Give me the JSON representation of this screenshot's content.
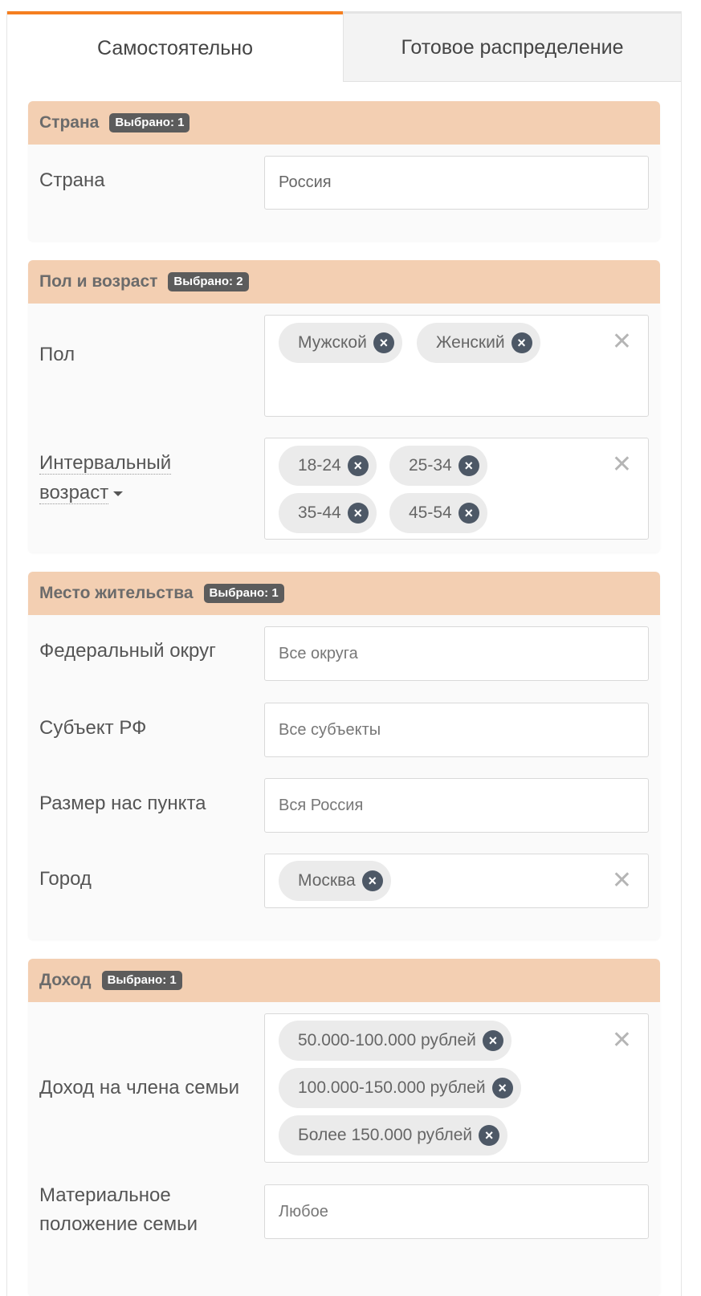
{
  "tabs": {
    "active": "Самостоятельно",
    "inactive": "Готовое распределение"
  },
  "colors": {
    "accent": "#f57f20",
    "section_header_bg": "#f3cfb2",
    "badge_bg": "#5c5c5c",
    "chip_bg": "#ebebeb",
    "chip_remove_bg": "#4d5866"
  },
  "icons": {
    "chip_remove": "close-circle-icon",
    "clear": "close-icon",
    "dropdown": "caret-down-icon"
  },
  "sections": {
    "country": {
      "title": "Страна",
      "badge": "Выбрано: 1",
      "label": "Страна",
      "value": "Россия"
    },
    "gender_age": {
      "title": "Пол и возраст",
      "badge": "Выбрано: 2",
      "gender_label": "Пол",
      "gender_chips": [
        "Мужской",
        "Женский"
      ],
      "age_label_1": "Интервальный",
      "age_label_2": "возраст",
      "age_chips": [
        "18-24",
        "25-34",
        "35-44",
        "45-54"
      ]
    },
    "residence": {
      "title": "Место жительства",
      "badge": "Выбрано: 1",
      "district_label": "Федеральный округ",
      "district_value": "Все округа",
      "subject_label": "Субъект РФ",
      "subject_value": "Все субъекты",
      "size_label": "Размер нас пункта",
      "size_value": "Вся Россия",
      "city_label": "Город",
      "city_chips": [
        "Москва"
      ]
    },
    "income": {
      "title": "Доход",
      "badge": "Выбрано: 1",
      "per_member_label": "Доход на члена семьи",
      "per_member_chips": [
        "50.000-100.000 рублей",
        "100.000-150.000 рублей",
        "Более 150.000 рублей"
      ],
      "material_label_1": "Материальное",
      "material_label_2": "положение семьи",
      "material_value": "Любое"
    }
  }
}
